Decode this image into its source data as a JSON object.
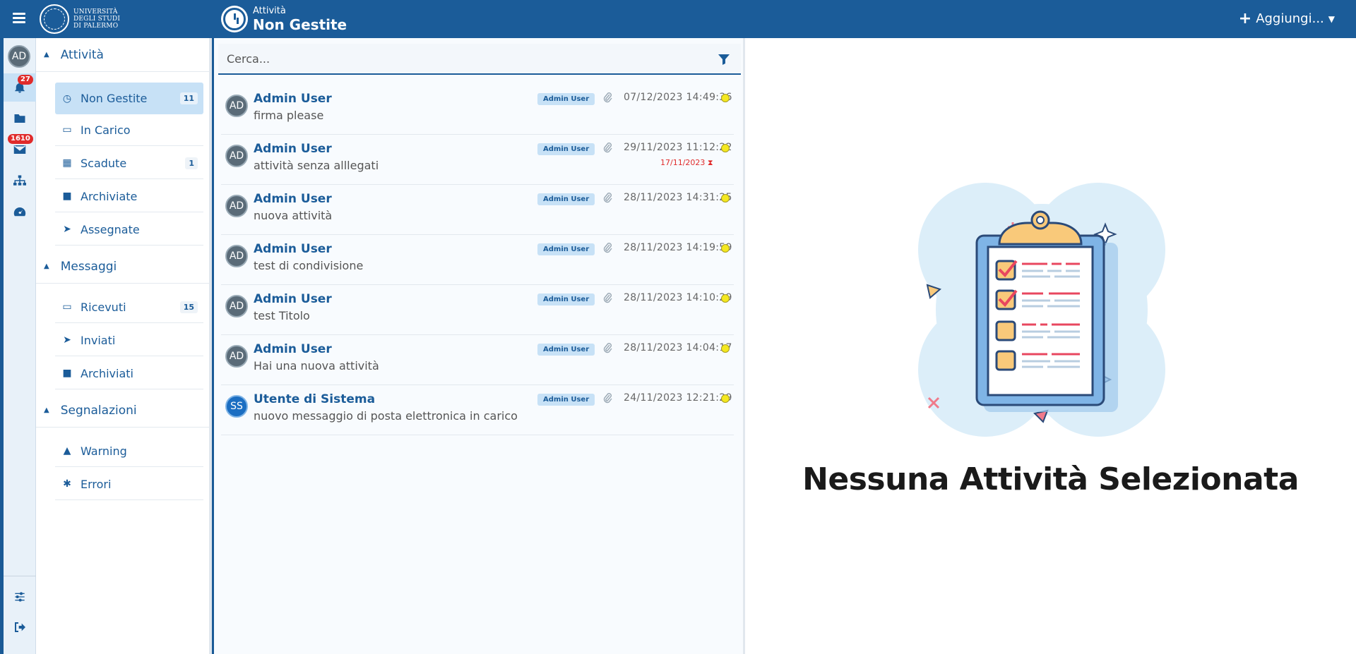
{
  "header": {
    "university_name_lines": [
      "Università",
      "degli Studi",
      "di Palermo"
    ],
    "section_label": "Attività",
    "page_title": "Non Gestite",
    "add_button_label": "Aggiungi..."
  },
  "rail": {
    "avatar_initials": "AD",
    "notifications_badge": "27",
    "mail_badge": "1610"
  },
  "nav": {
    "sections": [
      {
        "label": "Attività",
        "items": [
          {
            "label": "Non Gestite",
            "count": "11",
            "icon": "clock-icon"
          },
          {
            "label": "In Carico",
            "count": "",
            "icon": "inbox-icon"
          },
          {
            "label": "Scadute",
            "count": "1",
            "icon": "calendar-icon"
          },
          {
            "label": "Archiviate",
            "count": "",
            "icon": "folder-icon"
          },
          {
            "label": "Assegnate",
            "count": "",
            "icon": "paper-plane-icon"
          }
        ]
      },
      {
        "label": "Messaggi",
        "items": [
          {
            "label": "Ricevuti",
            "count": "15",
            "icon": "inbox-icon"
          },
          {
            "label": "Inviati",
            "count": "",
            "icon": "paper-plane-icon"
          },
          {
            "label": "Archiviati",
            "count": "",
            "icon": "folder-icon"
          }
        ]
      },
      {
        "label": "Segnalazioni",
        "items": [
          {
            "label": "Warning",
            "count": "",
            "icon": "warning-icon"
          },
          {
            "label": "Errori",
            "count": "",
            "icon": "bug-icon"
          }
        ]
      }
    ]
  },
  "search": {
    "placeholder": "Cerca..."
  },
  "list": {
    "rows": [
      {
        "initials": "AD",
        "sender": "Admin User",
        "subject": "firma please",
        "tag": "Admin User",
        "date": "07/12/2023 14:49:36",
        "due": ""
      },
      {
        "initials": "AD",
        "sender": "Admin User",
        "subject": "attività senza alllegati",
        "tag": "Admin User",
        "date": "29/11/2023 11:12:22",
        "due": "17/11/2023 ⧗"
      },
      {
        "initials": "AD",
        "sender": "Admin User",
        "subject": "nuova attività",
        "tag": "Admin User",
        "date": "28/11/2023 14:31:25",
        "due": ""
      },
      {
        "initials": "AD",
        "sender": "Admin User",
        "subject": "test di condivisione",
        "tag": "Admin User",
        "date": "28/11/2023 14:19:59",
        "due": ""
      },
      {
        "initials": "AD",
        "sender": "Admin User",
        "subject": "test Titolo",
        "tag": "Admin User",
        "date": "28/11/2023 14:10:29",
        "due": ""
      },
      {
        "initials": "AD",
        "sender": "Admin User",
        "subject": "Hai una nuova attività",
        "tag": "Admin User",
        "date": "28/11/2023 14:04:17",
        "due": ""
      },
      {
        "initials": "SS",
        "sender": "Utente di Sistema",
        "subject": "nuovo messaggio di posta elettronica in carico",
        "tag": "Admin User",
        "date": "24/11/2023 12:21:29",
        "due": ""
      }
    ]
  },
  "detail": {
    "empty_title": "Nessuna Attività Selezionata"
  },
  "colors": {
    "primary": "#1b5c99",
    "active_bg": "#c7e1f6",
    "badge_red": "#e02b2b",
    "status_yellow": "#f4e820"
  }
}
